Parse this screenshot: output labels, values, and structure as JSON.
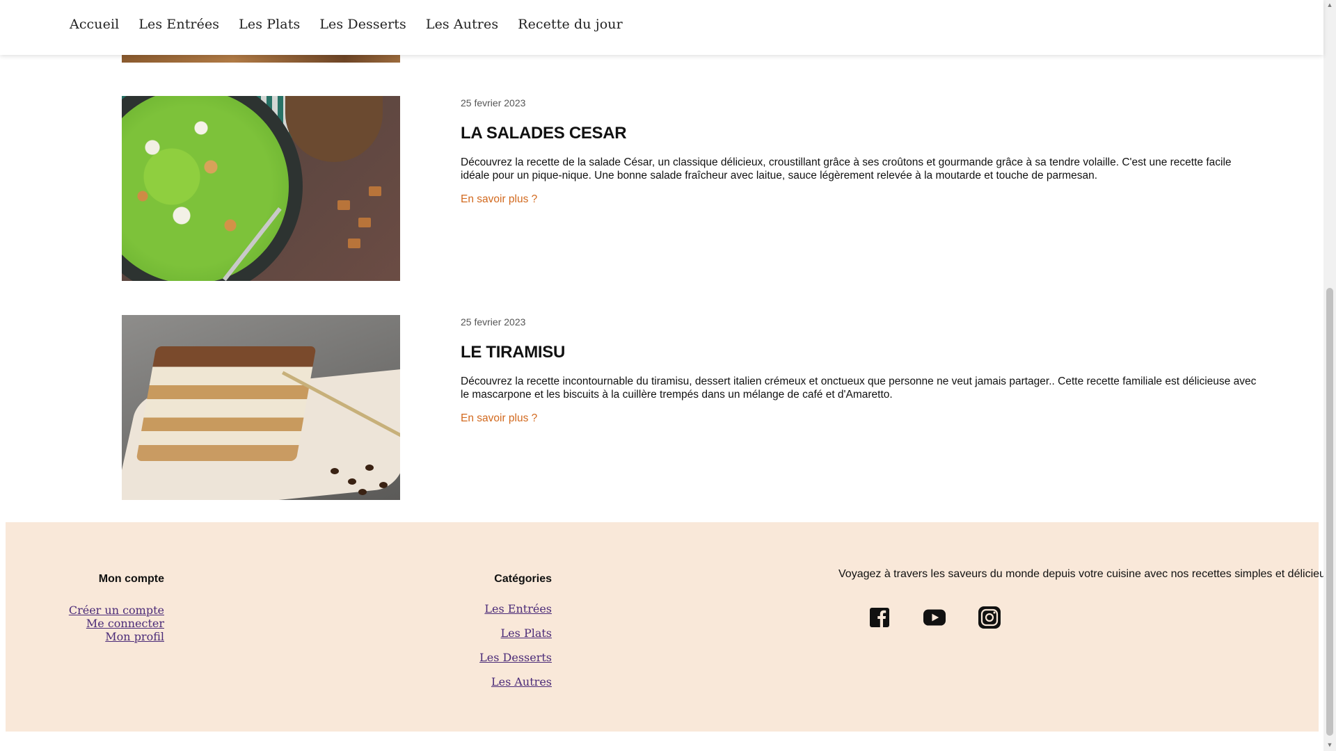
{
  "nav": {
    "items": [
      {
        "label": "Accueil"
      },
      {
        "label": "Les Entrées"
      },
      {
        "label": "Les Plats"
      },
      {
        "label": "Les Desserts"
      },
      {
        "label": "Les Autres"
      },
      {
        "label": "Recette du jour"
      }
    ]
  },
  "articles": [
    {
      "date": "25 fevrier 2023",
      "title": "LA SALADES CESAR",
      "description": "Découvrez la recette de la salade César, un classique délicieux, croustillant grâce à ses croûtons et gourmande grâce à sa tendre volaille. C'est une recette facile idéale pour un pique-nique. Une bonne salade fraîcheur avec laitue, sauce légèrement relevée à la moutarde et touche de parmesan.",
      "link": "En savoir plus ?"
    },
    {
      "date": "25 fevrier 2023",
      "title": "LE TIRAMISU",
      "description": "Découvrez la recette incontournable du tiramisu, dessert italien crémeux et onctueux que personne ne veut jamais partager.. Cette recette familiale est délicieuse avec le mascarpone et les biscuits à la cuillère trempés dans un mélange de café et d'Amaretto.",
      "link": "En savoir plus ?"
    }
  ],
  "footer": {
    "account": {
      "title": "Mon compte",
      "links": [
        "Créer un compte",
        "Me connecter",
        "Mon profil"
      ]
    },
    "categories": {
      "title": "Catégories",
      "links": [
        "Les Entrées",
        "Les Plats",
        "Les Desserts",
        "Les Autres"
      ]
    },
    "tagline": "Voyagez à travers les saveurs du monde depuis votre cuisine avec nos recettes simples et délicieuses",
    "socials": [
      "facebook-icon",
      "youtube-icon",
      "instagram-icon"
    ]
  },
  "colors": {
    "accent": "#d2691e",
    "footer_bg": "#f9e8d9",
    "link": "#4b2b78"
  }
}
